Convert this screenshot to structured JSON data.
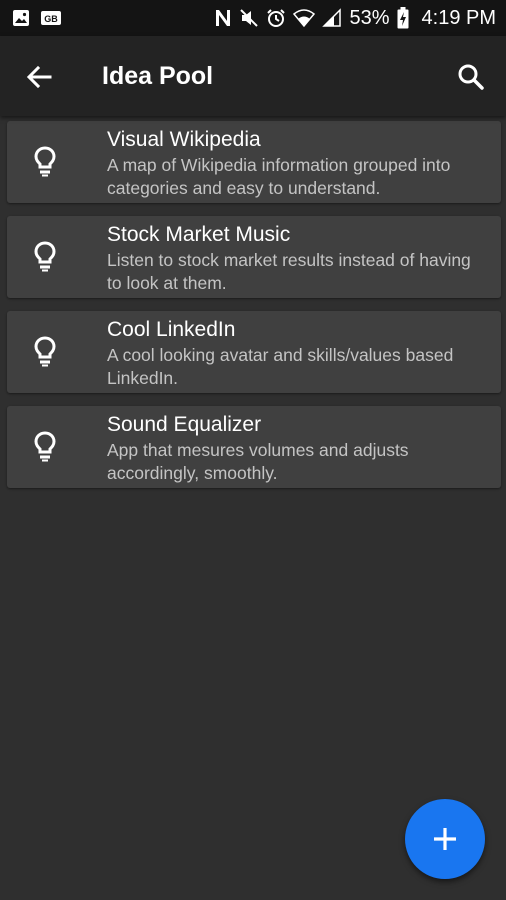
{
  "status_bar": {
    "icons": [
      "gallery-icon",
      "sd-card-icon",
      "nfc-icon",
      "mute-icon",
      "alarm-icon",
      "wifi-icon",
      "signal-icon",
      "battery-charging-icon"
    ],
    "battery_percent": "53%",
    "time": "4:19 PM"
  },
  "app_bar": {
    "title": "Idea Pool",
    "back_icon": "back-arrow-icon",
    "search_icon": "search-icon"
  },
  "ideas": [
    {
      "title": "Visual Wikipedia",
      "description": "A map of Wikipedia information grouped into categories and easy to understand.",
      "icon": "lightbulb-icon"
    },
    {
      "title": "Stock Market Music",
      "description": "Listen to stock market results instead of having to look at them.",
      "icon": "lightbulb-icon"
    },
    {
      "title": "Cool LinkedIn",
      "description": "A cool looking avatar and skills/values based LinkedIn.",
      "icon": "lightbulb-icon"
    },
    {
      "title": "Sound Equalizer",
      "description": "App that mesures volumes and adjusts accordingly, smoothly.",
      "icon": "lightbulb-icon"
    }
  ],
  "fab": {
    "icon": "plus-icon",
    "color": "#1976f0"
  },
  "colors": {
    "background": "#2f2f2f",
    "app_bar": "#232323",
    "card": "#404040",
    "status_bar": "#141414",
    "accent": "#1976f0"
  }
}
